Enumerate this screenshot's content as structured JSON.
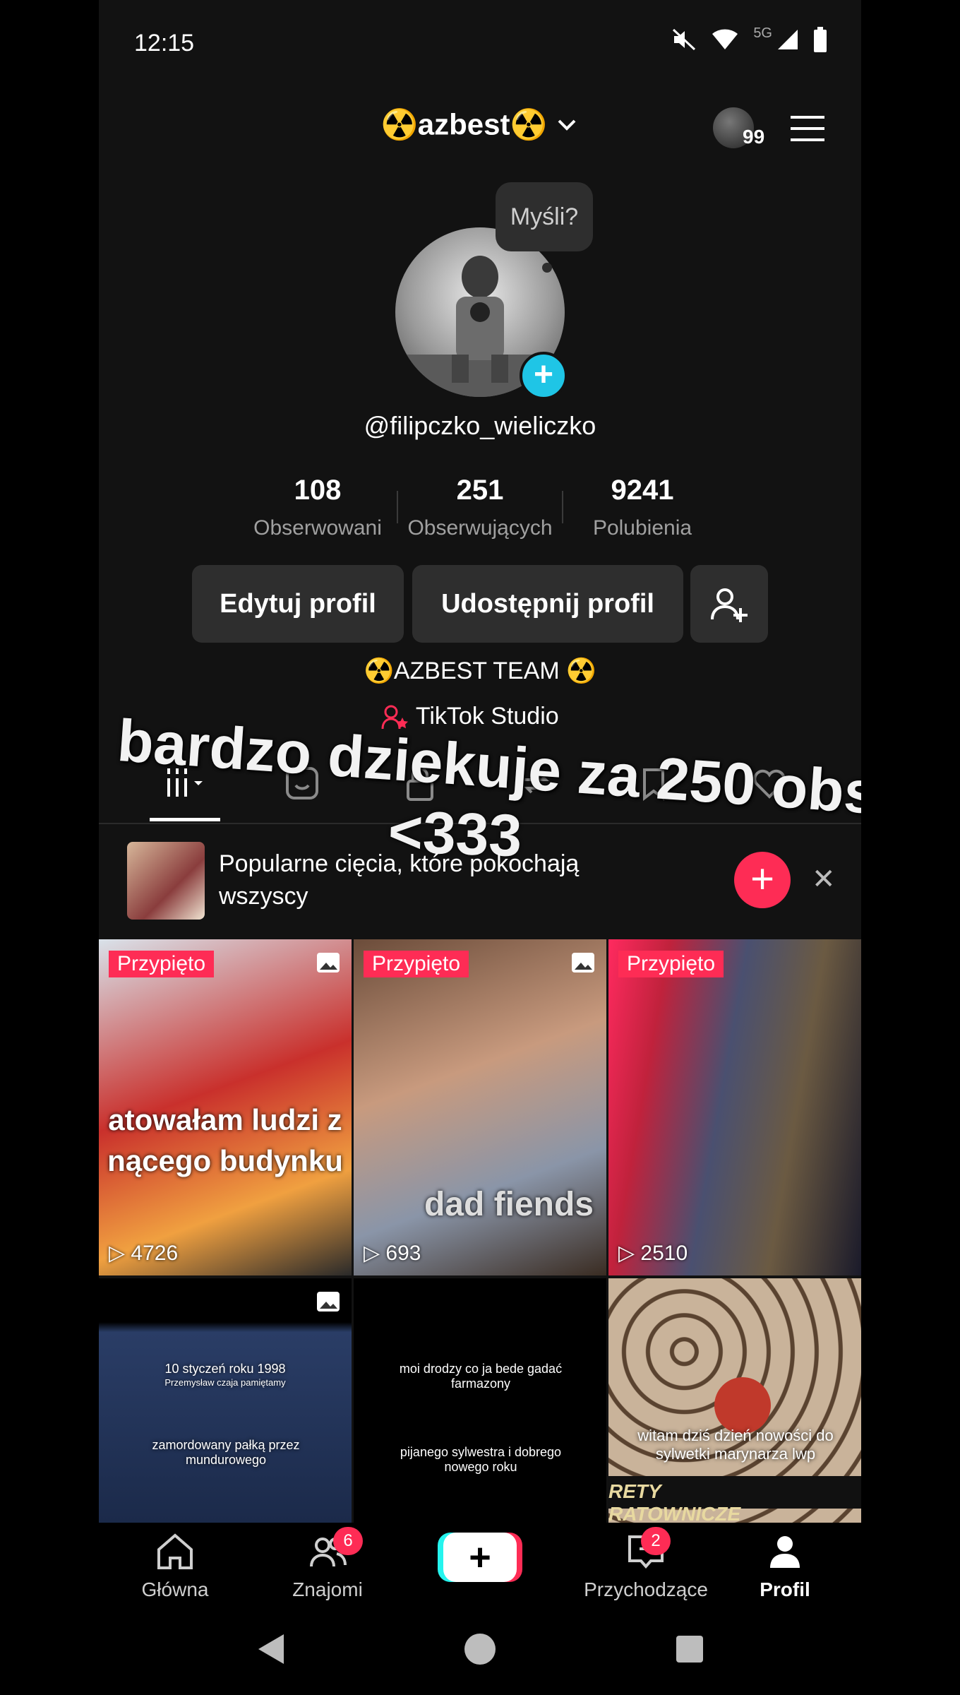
{
  "status": {
    "time": "12:15",
    "network": "5G"
  },
  "header": {
    "title": "☢️azbest☢️",
    "friends_count": "99"
  },
  "profile": {
    "bubble": "Myśli?",
    "username": "@filipczko_wieliczko",
    "stats": [
      {
        "value": "108",
        "label": "Obserwowani"
      },
      {
        "value": "251",
        "label": "Obserwujących"
      },
      {
        "value": "9241",
        "label": "Polubienia"
      }
    ],
    "buttons": {
      "edit": "Edytuj profil",
      "share": "Udostępnij profil"
    },
    "bio": "☢️AZBEST TEAM ☢️",
    "studio": "TikTok Studio"
  },
  "overlay": {
    "line1": "bardzo dziekuje za 250 obs",
    "line2": "<333"
  },
  "promo": {
    "text": "Popularne cięcia, które pokochają wszyscy"
  },
  "videos": [
    {
      "badge": "Przypięto",
      "views": "4726",
      "caption_line1": "atowałam ludzi z",
      "caption_line2": "nącego budynku",
      "bg": "#c9302c"
    },
    {
      "badge": "Przypięto",
      "views": "693",
      "caption_line1": "dad fiends",
      "bg": "#8d6b54"
    },
    {
      "badge": "Przypięto",
      "views": "2510",
      "bg": "#3a3f55"
    },
    {
      "caption_line1": "10 styczeń roku 1998",
      "caption_line2": "Przemysław czaja pamiętamy",
      "caption_line3": "zamordowany pałką przez mundurowego",
      "bg": "#1b2a4a"
    },
    {
      "caption_line1": "moi drodzy co ja bede gadać farmazony",
      "caption_line2": "pijanego sylwestra i dobrego nowego roku",
      "bg": "#000000"
    },
    {
      "caption_line1": "witam dziś dzień nowości do sylwetki marynarza lwp",
      "caption_line2": "RETY RATOWNICZE",
      "bg": "#b7a08a"
    }
  ],
  "nav": {
    "home": "Główna",
    "friends": "Znajomi",
    "friends_badge": "6",
    "inbox": "Przychodzące",
    "inbox_badge": "2",
    "profile": "Profil"
  }
}
